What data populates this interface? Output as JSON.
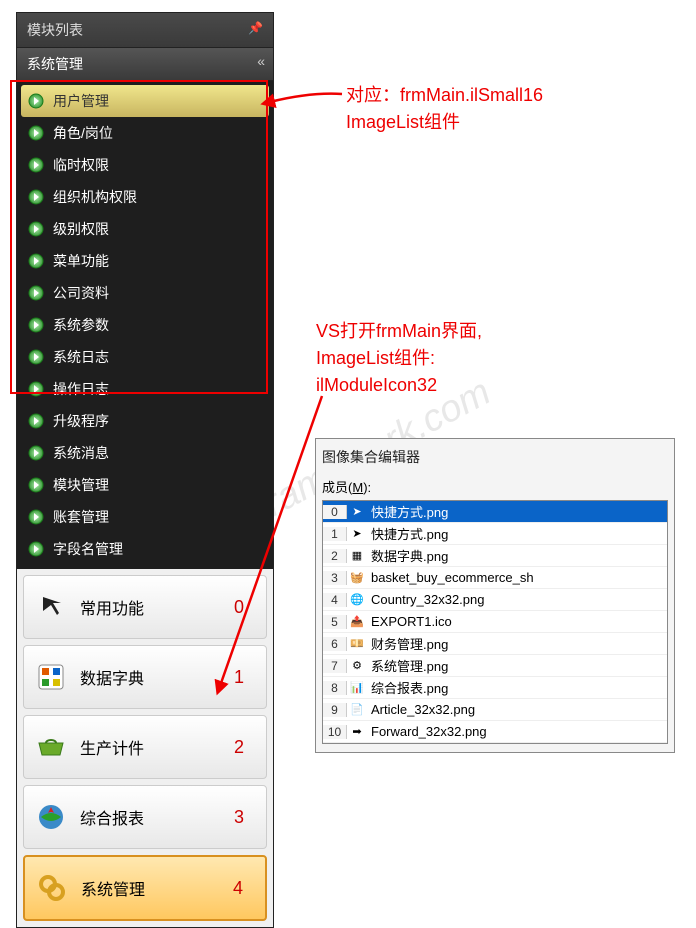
{
  "panel": {
    "title": "模块列表",
    "subheader": "系统管理"
  },
  "tree": {
    "items": [
      {
        "label": "用户管理"
      },
      {
        "label": "角色/岗位"
      },
      {
        "label": "临时权限"
      },
      {
        "label": "组织机构权限"
      },
      {
        "label": "级别权限"
      },
      {
        "label": "菜单功能"
      },
      {
        "label": "公司资料"
      },
      {
        "label": "系统参数"
      },
      {
        "label": "系统日志"
      },
      {
        "label": "操作日志"
      },
      {
        "label": "升级程序"
      },
      {
        "label": "系统消息"
      },
      {
        "label": "模块管理"
      },
      {
        "label": "账套管理"
      },
      {
        "label": "字段名管理"
      }
    ]
  },
  "big_buttons": [
    {
      "label": "常用功能",
      "idx": "0"
    },
    {
      "label": "数据字典",
      "idx": "1"
    },
    {
      "label": "生产计件",
      "idx": "2"
    },
    {
      "label": "综合报表",
      "idx": "3"
    },
    {
      "label": "系统管理",
      "idx": "4"
    }
  ],
  "annotation1": {
    "line1": "对应：frmMain.ilSmall16",
    "line2": "ImageList组件"
  },
  "annotation2": {
    "line1": "VS打开frmMain界面,",
    "line2": "ImageList组件:",
    "line3": "ilModuleIcon32"
  },
  "editor": {
    "title": "图像集合编辑器",
    "member_label": "成员(M):",
    "rows": [
      {
        "idx": "0",
        "name": "快捷方式.png"
      },
      {
        "idx": "1",
        "name": "快捷方式.png"
      },
      {
        "idx": "2",
        "name": "数据字典.png"
      },
      {
        "idx": "3",
        "name": "basket_buy_ecommerce_sh"
      },
      {
        "idx": "4",
        "name": "Country_32x32.png"
      },
      {
        "idx": "5",
        "name": "EXPORT1.ico"
      },
      {
        "idx": "6",
        "name": "财务管理.png"
      },
      {
        "idx": "7",
        "name": "系统管理.png"
      },
      {
        "idx": "8",
        "name": "综合报表.png"
      },
      {
        "idx": "9",
        "name": "Article_32x32.png"
      },
      {
        "idx": "10",
        "name": "Forward_32x32.png"
      }
    ]
  },
  "watermark": "www.esframework.com"
}
